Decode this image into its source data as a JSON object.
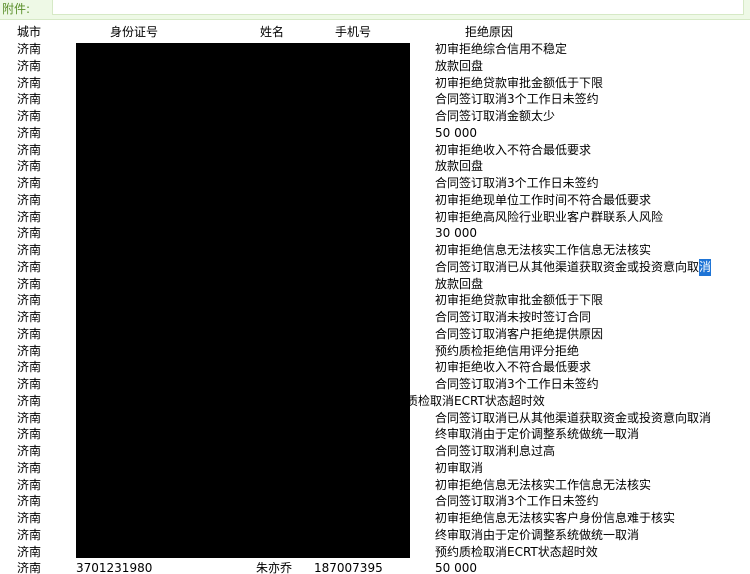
{
  "attachment": {
    "label": "附件:"
  },
  "table": {
    "headers": {
      "city": "城市",
      "id": "身份证号",
      "name": "姓名",
      "phone": "手机号",
      "reason": "拒绝原因"
    },
    "rows": [
      {
        "city": "济南",
        "reason": "初审拒绝综合信用不稳定"
      },
      {
        "city": "济南",
        "reason": "放款回盘"
      },
      {
        "city": "济南",
        "reason": "初审拒绝贷款审批金额低于下限"
      },
      {
        "city": "济南",
        "reason": "合同签订取消3个工作日未签约"
      },
      {
        "city": "济南",
        "reason": "合同签订取消金额太少"
      },
      {
        "city": "济南",
        "reason": "50 000"
      },
      {
        "city": "济南",
        "reason": "初审拒绝收入不符合最低要求"
      },
      {
        "city": "济南",
        "reason": "放款回盘"
      },
      {
        "city": "济南",
        "reason": "合同签订取消3个工作日未签约"
      },
      {
        "city": "济南",
        "reason": "初审拒绝现单位工作时间不符合最低要求"
      },
      {
        "city": "济南",
        "reason": "初审拒绝高风险行业职业客户群联系人风险"
      },
      {
        "city": "济南",
        "reason": "30 000"
      },
      {
        "city": "济南",
        "reason": "初审拒绝信息无法核实工作信息无法核实"
      },
      {
        "city": "济南",
        "reason": "合同签订取消已从其他渠道获取资金或投资意向取",
        "highlight": "消"
      },
      {
        "city": "济南",
        "reason": "放款回盘"
      },
      {
        "city": "济南",
        "reason": "初审拒绝贷款审批金额低于下限"
      },
      {
        "city": "济南",
        "reason": "合同签订取消未按时签订合同"
      },
      {
        "city": "济南",
        "reason": "合同签订取消客户拒绝提供原因"
      },
      {
        "city": "济南",
        "reason": "预约质检拒绝信用评分拒绝"
      },
      {
        "city": "济南",
        "reason": "初审拒绝收入不符合最低要求"
      },
      {
        "city": "济南",
        "reason": "合同签订取消3个工作日未签约"
      },
      {
        "city": "济南",
        "reason": "",
        "overflow": "质检取消ECRT状态超时效"
      },
      {
        "city": "济南",
        "reason": "合同签订取消已从其他渠道获取资金或投资意向取消"
      },
      {
        "city": "济南",
        "reason": "终审取消由于定价调整系统做统一取消"
      },
      {
        "city": "济南",
        "reason": "合同签订取消利息过高"
      },
      {
        "city": "济南",
        "reason": "初审取消"
      },
      {
        "city": "济南",
        "reason": "初审拒绝信息无法核实工作信息无法核实"
      },
      {
        "city": "济南",
        "reason": "合同签订取消3个工作日未签约"
      },
      {
        "city": "济南",
        "reason": "初审拒绝信息无法核实客户身份信息难于核实"
      },
      {
        "city": "济南",
        "reason": "终审取消由于定价调整系统做统一取消"
      },
      {
        "city": "济南",
        "reason": "预约质检取消ECRT状态超时效"
      }
    ],
    "cut_row": {
      "city": "济南",
      "id": "3701231980",
      "name": "朱亦乔",
      "phone": "187007395",
      "reason": "50 000"
    }
  }
}
